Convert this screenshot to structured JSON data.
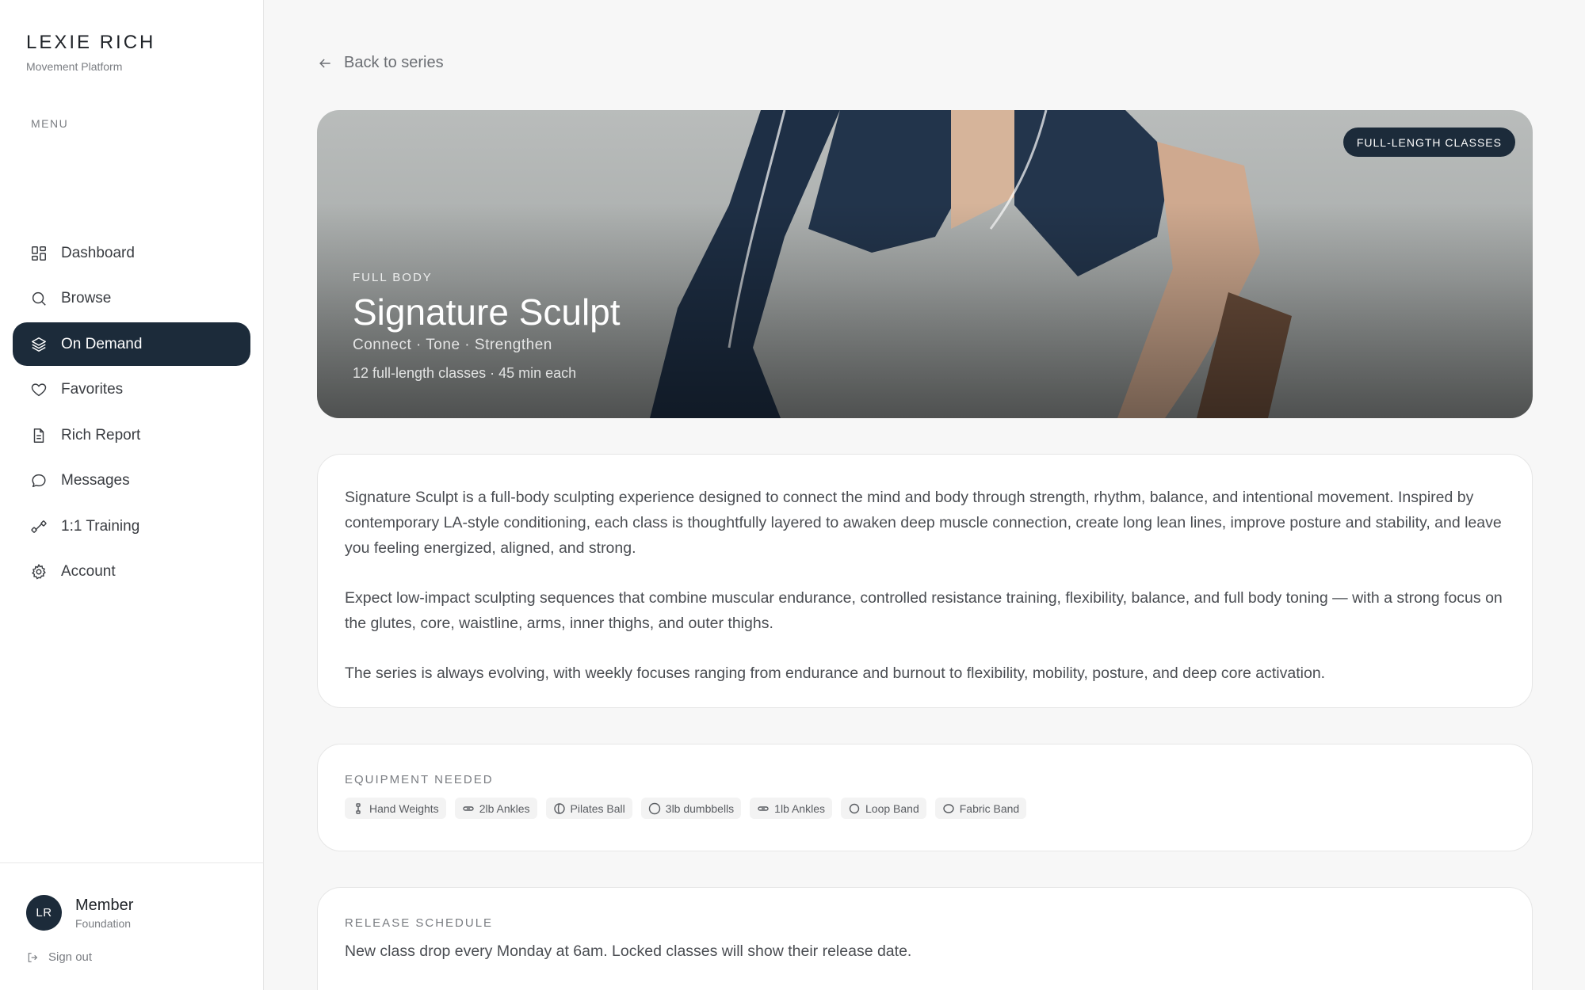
{
  "brand": {
    "name": "LEXIE RICH",
    "subtitle": "Movement Platform"
  },
  "sidebar": {
    "menu_label": "MENU",
    "items": [
      {
        "label": "Dashboard",
        "icon": "dashboard-icon",
        "active": false
      },
      {
        "label": "Browse",
        "icon": "search-icon",
        "active": false
      },
      {
        "label": "On Demand",
        "icon": "layers-icon",
        "active": true
      },
      {
        "label": "Favorites",
        "icon": "heart-icon",
        "active": false
      },
      {
        "label": "Rich Report",
        "icon": "document-icon",
        "active": false
      },
      {
        "label": "Messages",
        "icon": "chat-bubble-icon",
        "active": false
      },
      {
        "label": "1:1 Training",
        "icon": "dumbbell-icon",
        "active": false
      },
      {
        "label": "Account",
        "icon": "gear-icon",
        "active": false
      }
    ]
  },
  "user": {
    "initials": "LR",
    "name": "Member",
    "tier": "Foundation",
    "signout": "Sign out"
  },
  "back_link": "Back to series",
  "hero": {
    "badge": "FULL-LENGTH CLASSES",
    "category": "FULL BODY",
    "title": "Signature Sculpt",
    "tagline": "Connect · Tone · Strengthen",
    "meta": "12 full-length classes · 45 min each"
  },
  "description": [
    "Signature Sculpt is a full-body sculpting experience designed to connect the mind and body through strength, rhythm, balance, and intentional movement. Inspired by contemporary LA-style conditioning, each class is thoughtfully layered to awaken deep muscle connection, create long lean lines, improve posture and stability, and leave you feeling energized, aligned, and strong.",
    "Expect low-impact sculpting sequences that combine muscular endurance, controlled resistance training, flexibility, balance, and full body toning — with a strong focus on the glutes, core, waistline, arms, inner thighs, and outer thighs.",
    "The series is always evolving, with weekly focuses ranging from endurance and burnout to flexibility, mobility, posture, and deep core activation."
  ],
  "equipment": {
    "label": "EQUIPMENT NEEDED",
    "items": [
      {
        "label": "Hand Weights",
        "icon": "hand-weight-icon"
      },
      {
        "label": "2lb Ankles",
        "icon": "ankle-weight-icon"
      },
      {
        "label": "Pilates Ball",
        "icon": "ball-icon"
      },
      {
        "label": "3lb dumbbells",
        "icon": "circle-icon"
      },
      {
        "label": "1lb Ankles",
        "icon": "ankle-weight-icon"
      },
      {
        "label": "Loop Band",
        "icon": "loop-band-icon"
      },
      {
        "label": "Fabric Band",
        "icon": "fabric-band-icon"
      }
    ]
  },
  "release": {
    "label": "RELEASE SCHEDULE",
    "text": "New class drop every Monday at 6am. Locked classes will show their release date."
  }
}
